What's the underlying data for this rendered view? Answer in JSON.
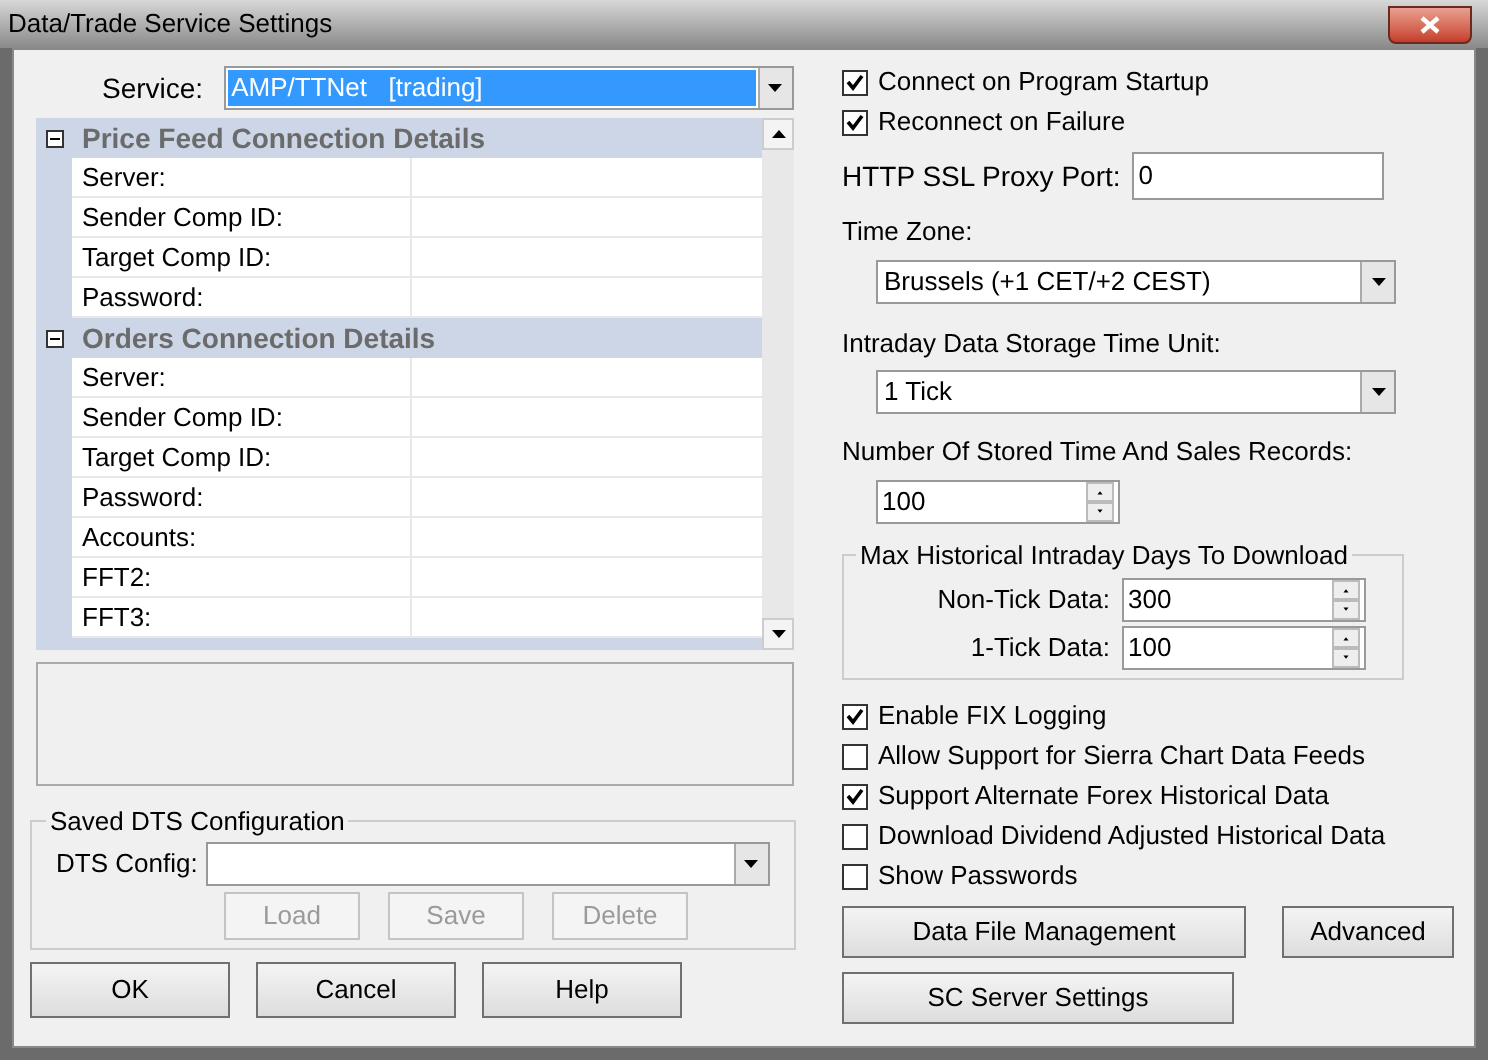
{
  "window": {
    "title": "Data/Trade Service Settings"
  },
  "service": {
    "label": "Service:",
    "value": "AMP/TTNet   [trading]"
  },
  "property_grid": {
    "groups": [
      {
        "title": "Price Feed Connection Details",
        "expanded": true,
        "rows": [
          "Server:",
          "Sender Comp ID:",
          "Target Comp ID:",
          "Password:"
        ]
      },
      {
        "title": "Orders Connection Details",
        "expanded": true,
        "rows": [
          "Server:",
          "Sender Comp ID:",
          "Target Comp ID:",
          "Password:",
          "Accounts:",
          "FFT2:",
          "FFT3:"
        ]
      }
    ]
  },
  "saved_config": {
    "title": "Saved DTS Configuration",
    "label": "DTS Config:",
    "buttons": [
      {
        "label": "Load",
        "disabled": true
      },
      {
        "label": "Save",
        "disabled": true
      },
      {
        "label": "Delete",
        "disabled": true
      }
    ]
  },
  "dialog_buttons": [
    "OK",
    "Cancel",
    "Help"
  ],
  "top_checkboxes": [
    {
      "label": "Connect on Program Startup",
      "checked": true
    },
    {
      "label": "Reconnect on Failure",
      "checked": true
    }
  ],
  "proxy_port": {
    "label": "HTTP SSL Proxy Port:",
    "value": "0"
  },
  "time_zone": {
    "label": "Time Zone:",
    "value": "Brussels (+1 CET/+2 CEST)"
  },
  "storage_unit": {
    "label": "Intraday Data Storage Time Unit:",
    "value": "1 Tick"
  },
  "stored_records": {
    "label": "Number Of Stored Time And Sales Records:",
    "value": "100"
  },
  "max_days": {
    "title": "Max Historical Intraday Days To Download",
    "fields": [
      {
        "label": "Non-Tick Data:",
        "value": "300"
      },
      {
        "label": "1-Tick Data:",
        "value": "100"
      }
    ]
  },
  "bottom_checkboxes": [
    {
      "label": "Enable FIX Logging",
      "checked": true
    },
    {
      "label": "Allow Support for Sierra Chart Data Feeds",
      "checked": false
    },
    {
      "label": "Support Alternate Forex Historical Data",
      "checked": true
    },
    {
      "label": "Download Dividend Adjusted Historical Data",
      "checked": false
    },
    {
      "label": "Show Passwords",
      "checked": false
    }
  ],
  "side_buttons": [
    "Data File Management",
    "Advanced",
    "SC Server Settings"
  ]
}
